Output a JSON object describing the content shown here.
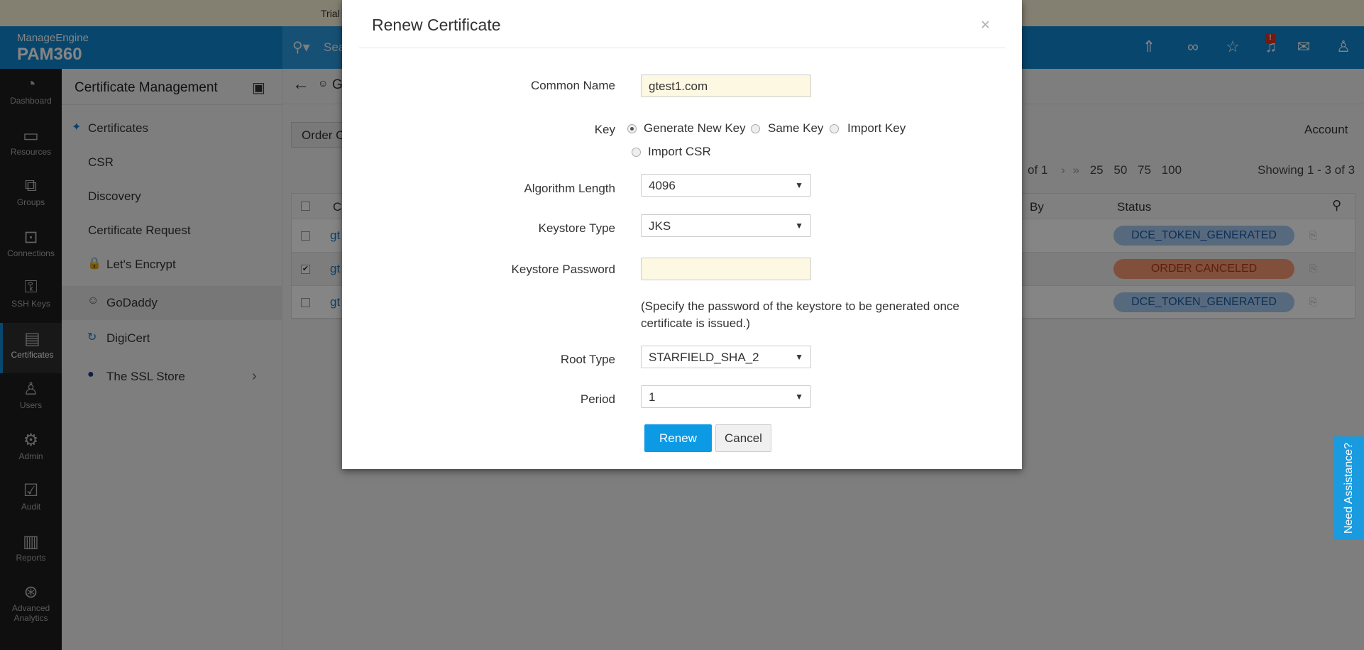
{
  "banner": {
    "text": "Trial"
  },
  "header": {
    "brand": "ManageEngine",
    "product": "PAM360",
    "search_placeholder": "Sea",
    "icons": [
      "rocket-icon",
      "link-icon",
      "user-star-icon",
      "bell-icon",
      "mail-icon",
      "user-icon"
    ],
    "alert_badge": "!"
  },
  "leftnav": [
    {
      "label": "Dashboard",
      "icon": "◔"
    },
    {
      "label": "Resources",
      "icon": "▭"
    },
    {
      "label": "Groups",
      "icon": "⧉"
    },
    {
      "label": "Connections",
      "icon": "⊡"
    },
    {
      "label": "SSH Keys",
      "icon": "⚿"
    },
    {
      "label": "Certificates",
      "icon": "▤"
    },
    {
      "label": "Users",
      "icon": "♙"
    },
    {
      "label": "Admin",
      "icon": "⚙"
    },
    {
      "label": "Audit",
      "icon": "☑"
    },
    {
      "label": "Reports",
      "icon": "▥"
    },
    {
      "label": "Advanced Analytics",
      "icon": "⊛"
    }
  ],
  "subnav": {
    "title": "Certificate Management",
    "items": [
      {
        "label": "Certificates"
      },
      {
        "label": "CSR"
      },
      {
        "label": "Discovery"
      },
      {
        "label": "Certificate Request"
      },
      {
        "label": "Let's Encrypt"
      },
      {
        "label": "GoDaddy"
      },
      {
        "label": "DigiCert"
      },
      {
        "label": "The SSL Store"
      }
    ]
  },
  "main": {
    "page_title": "G",
    "order_button": "Order C",
    "account_label": "Account",
    "pager": {
      "of": "of 1",
      "sizes": [
        "25",
        "50",
        "75",
        "100"
      ]
    },
    "showing": "Showing 1 - 3 of 3",
    "table": {
      "headers": [
        "C",
        "By",
        "Status"
      ],
      "rows": [
        {
          "name": "gt",
          "status": "DCE_TOKEN_GENERATED",
          "checked": false
        },
        {
          "name": "gt",
          "status": "ORDER CANCELED",
          "checked": true
        },
        {
          "name": "gt",
          "status": "DCE_TOKEN_GENERATED",
          "checked": false
        }
      ]
    }
  },
  "modal": {
    "title": "Renew Certificate",
    "close": "×",
    "common_name": {
      "label": "Common Name",
      "value": "gtest1.com"
    },
    "key": {
      "label": "Key",
      "options": [
        "Generate New Key",
        "Same Key",
        "Import Key",
        "Import CSR"
      ],
      "selected": "Generate New Key"
    },
    "algorithm_length": {
      "label": "Algorithm Length",
      "value": "4096"
    },
    "keystore_type": {
      "label": "Keystore Type",
      "value": "JKS"
    },
    "keystore_password": {
      "label": "Keystore Password",
      "value": ""
    },
    "note": "(Specify the password of the keystore to be generated once certificate is issued.)",
    "root_type": {
      "label": "Root Type",
      "value": "STARFIELD_SHA_2"
    },
    "period": {
      "label": "Period",
      "value": "1"
    },
    "renew_button": "Renew",
    "cancel_button": "Cancel"
  },
  "assist": "Need Assistance?",
  "colors": {
    "brand_blue": "#1187d2",
    "primary_button": "#0d9ae4",
    "status_blue": "#a8c9f0",
    "status_red": "#f59a75"
  }
}
